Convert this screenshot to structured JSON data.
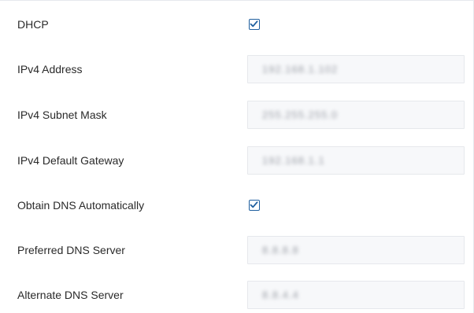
{
  "form": {
    "dhcp": {
      "label": "DHCP",
      "checked": true
    },
    "ipv4_address": {
      "label": "IPv4 Address",
      "value": "192.168.1.102"
    },
    "ipv4_subnet_mask": {
      "label": "IPv4 Subnet Mask",
      "value": "255.255.255.0"
    },
    "ipv4_default_gateway": {
      "label": "IPv4 Default Gateway",
      "value": "192.168.1.1"
    },
    "obtain_dns_automatically": {
      "label": "Obtain DNS Automatically",
      "checked": true
    },
    "preferred_dns_server": {
      "label": "Preferred DNS Server",
      "value": "8.8.8.8"
    },
    "alternate_dns_server": {
      "label": "Alternate DNS Server",
      "value": "8.8.4.4"
    }
  },
  "colors": {
    "checkbox_border": "#1f5f9f",
    "field_background": "#f7f8fa",
    "label_text": "#2a2a2a"
  },
  "icons": {
    "checkbox_checked": "check-icon"
  }
}
